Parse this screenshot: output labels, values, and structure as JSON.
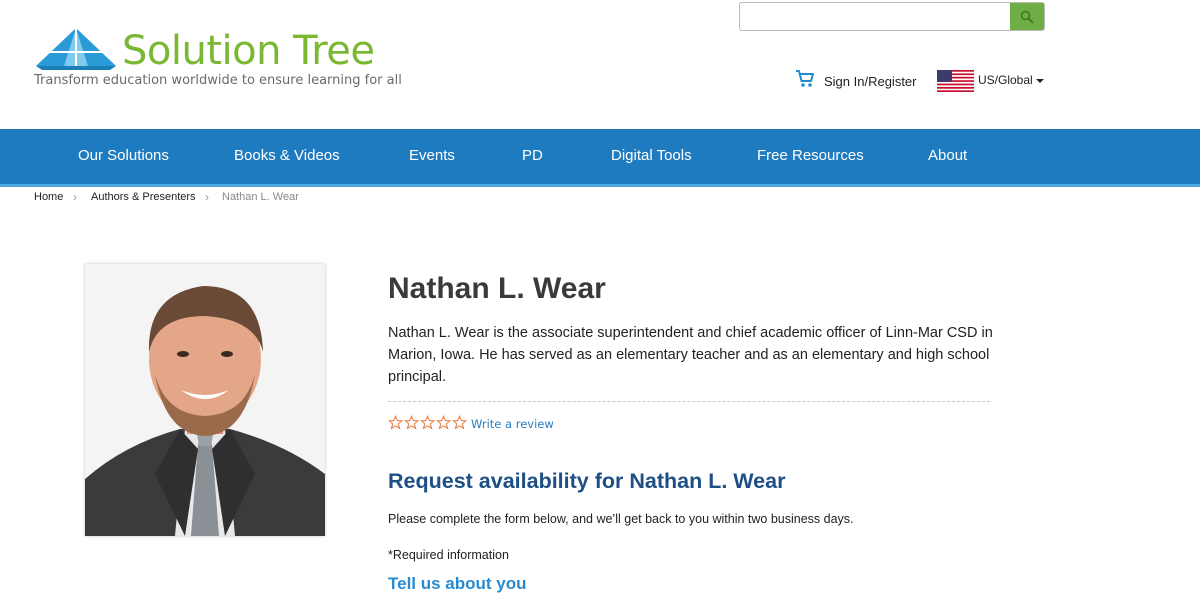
{
  "header": {
    "brand": "Solution Tree",
    "tagline": "Transform education worldwide to ensure learning for all",
    "search": {
      "value": "",
      "placeholder": ""
    },
    "sign_in": "Sign In/Register",
    "region": "US/Global"
  },
  "nav": {
    "items": [
      "Our Solutions",
      "Books & Videos",
      "Events",
      "PD",
      "Digital Tools",
      "Free Resources",
      "About"
    ]
  },
  "breadcrumb": {
    "items": [
      "Home",
      "Authors & Presenters",
      "Nathan L. Wear"
    ]
  },
  "author": {
    "name": "Nathan L. Wear",
    "bio": "Nathan L. Wear is the associate superintendent and chief academic officer of Linn-Mar CSD in Marion, Iowa. He has served as an elementary teacher and as an elementary and high school principal.",
    "rating": 0,
    "rating_max": 5,
    "write_review": "Write a review"
  },
  "request": {
    "title": "Request availability for Nathan L. Wear",
    "description": "Please complete the form below, and we’ll get back to you within two business days.",
    "required_note": "*Required information",
    "section_heading": "Tell us about you"
  },
  "colors": {
    "brand_green": "#7ab733",
    "nav_blue": "#1f7bbf",
    "heading_blue": "#1d4f86",
    "link_blue": "#2a7bbf",
    "star_orange": "#e07b39"
  },
  "icons": {
    "logo": "logo-icon",
    "search": "search-icon",
    "cart": "cart-icon",
    "flag": "us-flag-icon",
    "star": "star-outline-icon"
  }
}
